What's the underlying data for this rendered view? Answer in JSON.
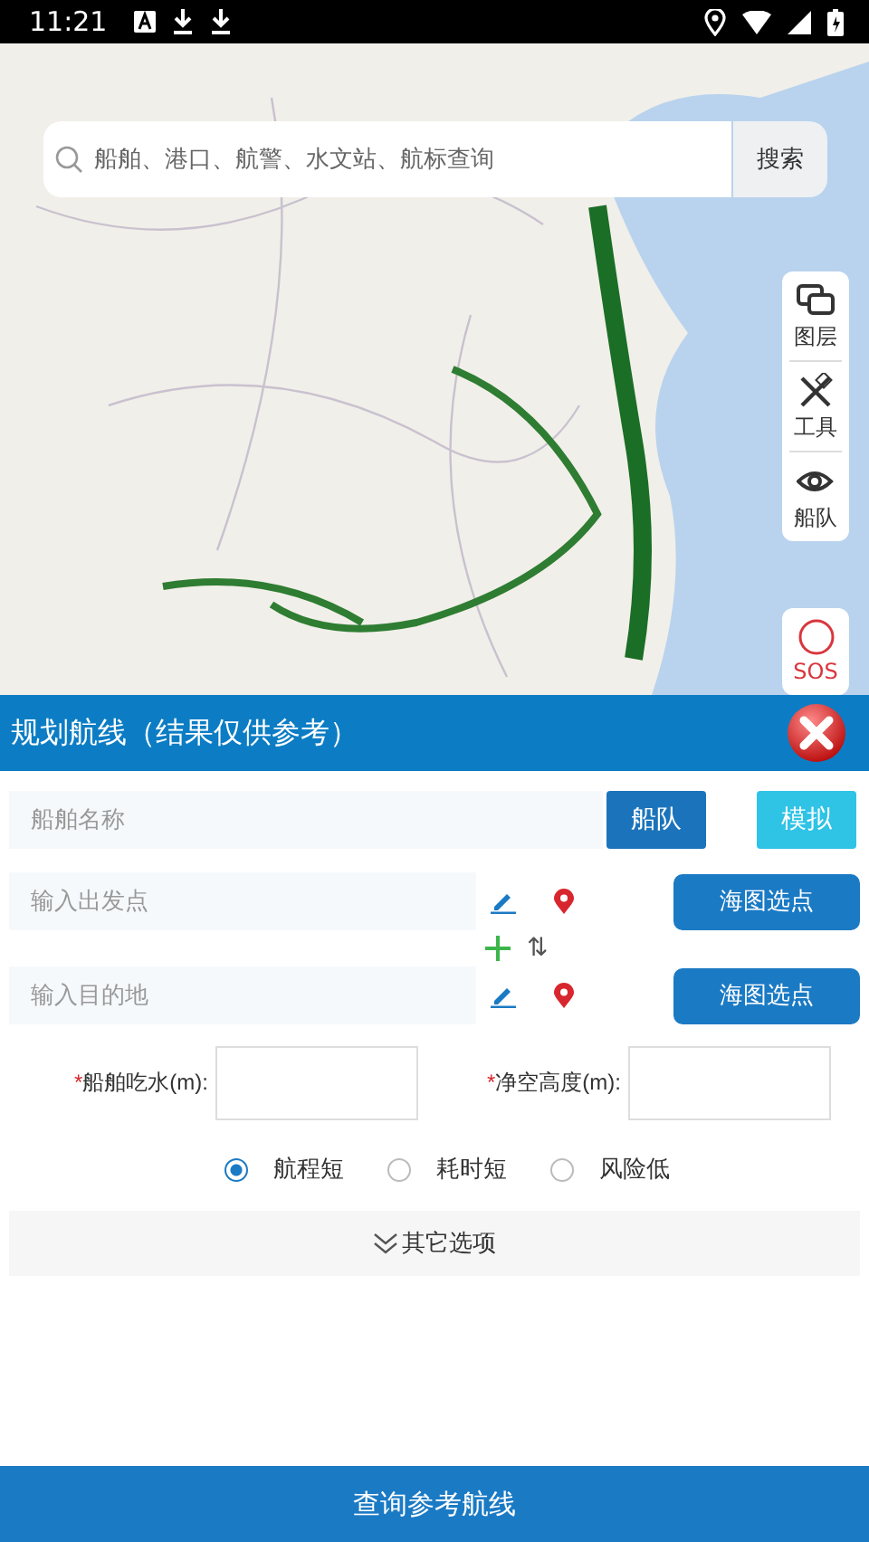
{
  "status_bar": {
    "time": "11:21"
  },
  "search": {
    "placeholder": "船舶、港口、航警、水文站、航标查询",
    "button": "搜索"
  },
  "map_tools": [
    {
      "kind": "layers",
      "label": "图层"
    },
    {
      "kind": "tools",
      "label": "工具"
    },
    {
      "kind": "fleet",
      "label": "船队"
    }
  ],
  "sos": {
    "label": "SOS"
  },
  "panel": {
    "title": "规划航线（结果仅供参考）",
    "ship_name": {
      "placeholder": "船舶名称"
    },
    "fleet_button": "船队",
    "simulate_button": "模拟",
    "origin": {
      "placeholder": "输入出发点",
      "button": "海图选点"
    },
    "swap_glyph": "⇅",
    "destination": {
      "placeholder": "输入目的地",
      "button": "海图选点"
    },
    "params": [
      {
        "mark": "*",
        "label": "船舶吃水(m):"
      },
      {
        "mark": "*",
        "label": "净空高度(m):"
      }
    ],
    "route_options": [
      {
        "label": "航程短",
        "selected": true
      },
      {
        "label": "耗时短",
        "selected": false
      },
      {
        "label": "风险低",
        "selected": false
      }
    ],
    "more_options": "其它选项",
    "submit": "查询参考航线"
  }
}
